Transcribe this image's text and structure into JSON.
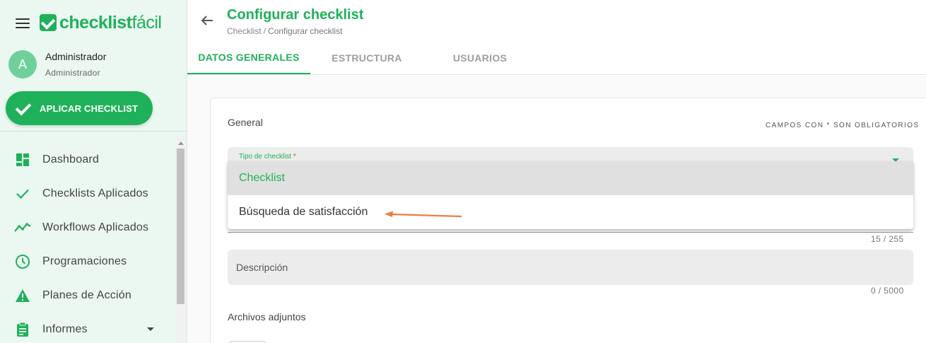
{
  "brand": {
    "name_bold": "checklist",
    "name_light": "fácil",
    "color": "#1fb15a"
  },
  "user": {
    "initial": "A",
    "name": "Administrador",
    "role": "Administrador"
  },
  "sidebar": {
    "apply_button": "APLICAR CHECKLIST",
    "items": [
      {
        "label": "Dashboard",
        "icon": "dashboard-icon"
      },
      {
        "label": "Checklists Aplicados",
        "icon": "check-icon"
      },
      {
        "label": "Workflows Aplicados",
        "icon": "trending-icon"
      },
      {
        "label": "Programaciones",
        "icon": "clock-icon"
      },
      {
        "label": "Planes de Acción",
        "icon": "warning-icon"
      },
      {
        "label": "Informes",
        "icon": "clipboard-icon"
      }
    ]
  },
  "header": {
    "title": "Configurar checklist",
    "breadcrumb": {
      "parent": "Checklist",
      "separator": "/",
      "current": "Configurar checklist"
    }
  },
  "tabs": [
    {
      "label": "DATOS GENERALES",
      "active": true
    },
    {
      "label": "ESTRUCTURA",
      "active": false
    },
    {
      "label": "USUARIOS",
      "active": false
    }
  ],
  "form": {
    "section_title": "General",
    "required_note": "CAMPOS CON * SON OBLIGATORIOS",
    "tipo": {
      "label": "Tipo de checklist",
      "required_mark": "*",
      "options": [
        "Checklist",
        "Búsqueda de satisfacción"
      ],
      "selected": "Checklist"
    },
    "name_counter": "15 / 255",
    "description": {
      "placeholder": "Descripción",
      "counter": "0 / 5000"
    },
    "attachments_title": "Archivos adjuntos"
  },
  "colors": {
    "accent": "#1fb15a",
    "annotation_arrow": "#f07c3c",
    "sidebar_bg": "#eaf8f1"
  }
}
